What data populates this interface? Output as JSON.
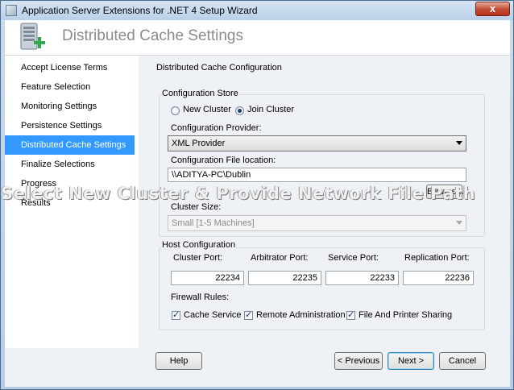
{
  "window": {
    "title": "Application Server Extensions for .NET 4 Setup Wizard",
    "close_label": "x"
  },
  "header": {
    "title": "Distributed Cache Settings"
  },
  "sidebar": {
    "items": [
      {
        "label": "Accept License Terms",
        "active": false
      },
      {
        "label": "Feature Selection",
        "active": false
      },
      {
        "label": "Monitoring Settings",
        "active": false
      },
      {
        "label": "Persistence Settings",
        "active": false
      },
      {
        "label": "Distributed Cache Settings",
        "active": true
      },
      {
        "label": "Finalize Selections",
        "active": false
      },
      {
        "label": "Progress",
        "active": false
      },
      {
        "label": "Results",
        "active": false
      }
    ]
  },
  "content": {
    "title": "Distributed Cache Configuration",
    "config_store": {
      "group_label": "Configuration Store",
      "new_cluster_label": "New Cluster",
      "join_cluster_label": "Join Cluster",
      "selected": "Join Cluster",
      "provider_label": "Configuration Provider:",
      "provider_value": "XML Provider",
      "file_location_label": "Configuration File location:",
      "file_location_value": "\\\\ADITYA-PC\\Dublin",
      "browse_label": "Browse...",
      "cluster_size_label": "Cluster Size:",
      "cluster_size_value": "Small [1-5 Machines]"
    },
    "host_config": {
      "group_label": "Host Configuration",
      "ports": [
        {
          "label": "Cluster Port:",
          "value": "22234"
        },
        {
          "label": "Arbitrator Port:",
          "value": "22235"
        },
        {
          "label": "Service Port:",
          "value": "22233"
        },
        {
          "label": "Replication Port:",
          "value": "22236"
        }
      ],
      "firewall_label": "Firewall Rules:",
      "firewall_rules": [
        {
          "label": "Cache Service",
          "checked": true
        },
        {
          "label": "Remote Administration",
          "checked": true
        },
        {
          "label": "File And Printer Sharing",
          "checked": true
        }
      ]
    }
  },
  "watermark": "Select New Cluster & Provide Network File Path",
  "footer": {
    "help": "Help",
    "previous": "< Previous",
    "next": "Next >",
    "cancel": "Cancel"
  },
  "colors": {
    "accent": "#3399ff",
    "header_title": "#8c8c8c"
  }
}
